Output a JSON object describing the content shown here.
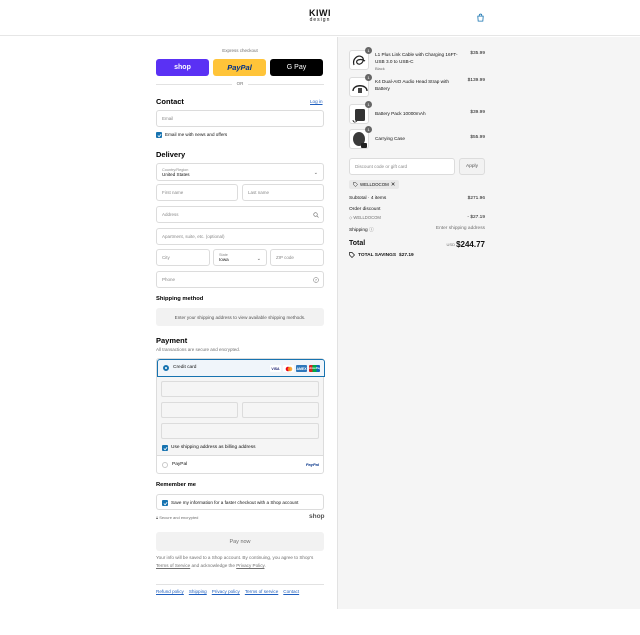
{
  "brand": {
    "line1": "KIWI",
    "line2": "design"
  },
  "express": {
    "label": "Express checkout",
    "shop": "shop",
    "paypal": "PayPal",
    "gpay": "G Pay",
    "or": "OR"
  },
  "contact": {
    "title": "Contact",
    "login": "Log in",
    "email_placeholder": "Email",
    "newsletter": "Email me with news and offers"
  },
  "delivery": {
    "title": "Delivery",
    "country_label": "Country/Region",
    "country_value": "United States",
    "first_name": "First name",
    "last_name": "Last name",
    "address": "Address",
    "apartment": "Apartment, suite, etc. (optional)",
    "city": "City",
    "state_label": "State",
    "state_value": "Iowa",
    "zip": "ZIP code",
    "phone": "Phone"
  },
  "shipping": {
    "title": "Shipping method",
    "info": "Enter your shipping address to view available shipping methods."
  },
  "payment": {
    "title": "Payment",
    "subtitle": "All transactions are secure and encrypted.",
    "credit_card": "Credit card",
    "card_brands": [
      "VISA",
      "MC",
      "AMEX",
      "UnionPay"
    ],
    "billing_same": "Use shipping address as billing address",
    "paypal": "PayPal",
    "paypal_logo": "PayPal"
  },
  "remember": {
    "title": "Remember me",
    "save_info": "Save my information for a faster checkout with a Shop account",
    "secure": "Secure and encrypted",
    "shop_word": "shop"
  },
  "paynow": "Pay now",
  "legal": {
    "text1": "Your info will be saved to a Shop account. By continuing, you agree to Shop's",
    "terms": "Terms of Service",
    "text2": "and acknowledge the",
    "privacy": "Privacy Policy",
    "text3": "."
  },
  "footer": {
    "links": [
      "Refund policy",
      "Shipping",
      "Privacy policy",
      "Terms of service",
      "Contact"
    ]
  },
  "cart": {
    "items": [
      {
        "qty": "1",
        "name": "L1 Plus Link Cable with Charging 16FT- USB 3.0 to USB-C",
        "variant": "Black",
        "price": "$35.99"
      },
      {
        "qty": "1",
        "name": "K4 Dual-AIO Audio Head Strap with Battery",
        "variant": "",
        "price": "$139.99"
      },
      {
        "qty": "1",
        "name": "Battery Pack 10000mAh",
        "variant": "",
        "price": "$39.99"
      },
      {
        "qty": "1",
        "name": "Carrying Case",
        "variant": "",
        "price": "$55.99"
      }
    ],
    "discount_placeholder": "Discount code or gift card",
    "apply": "Apply",
    "tag": "WELLDOCOM",
    "subtotal_label": "Subtotal · 4 items",
    "subtotal_value": "$271.96",
    "order_discount_label": "Order discount",
    "discount_code": "WELLDOCOM",
    "discount_value": "- $27.19",
    "shipping_label": "Shipping",
    "shipping_value": "Enter shipping address",
    "total_label": "Total",
    "currency": "USD",
    "total_value": "$244.77",
    "savings_label": "TOTAL SAVINGS",
    "savings_value": "$27.19"
  },
  "colors": {
    "accent": "#1773b0",
    "shop_purple": "#5a31f4",
    "paypal_yellow": "#ffc439"
  }
}
